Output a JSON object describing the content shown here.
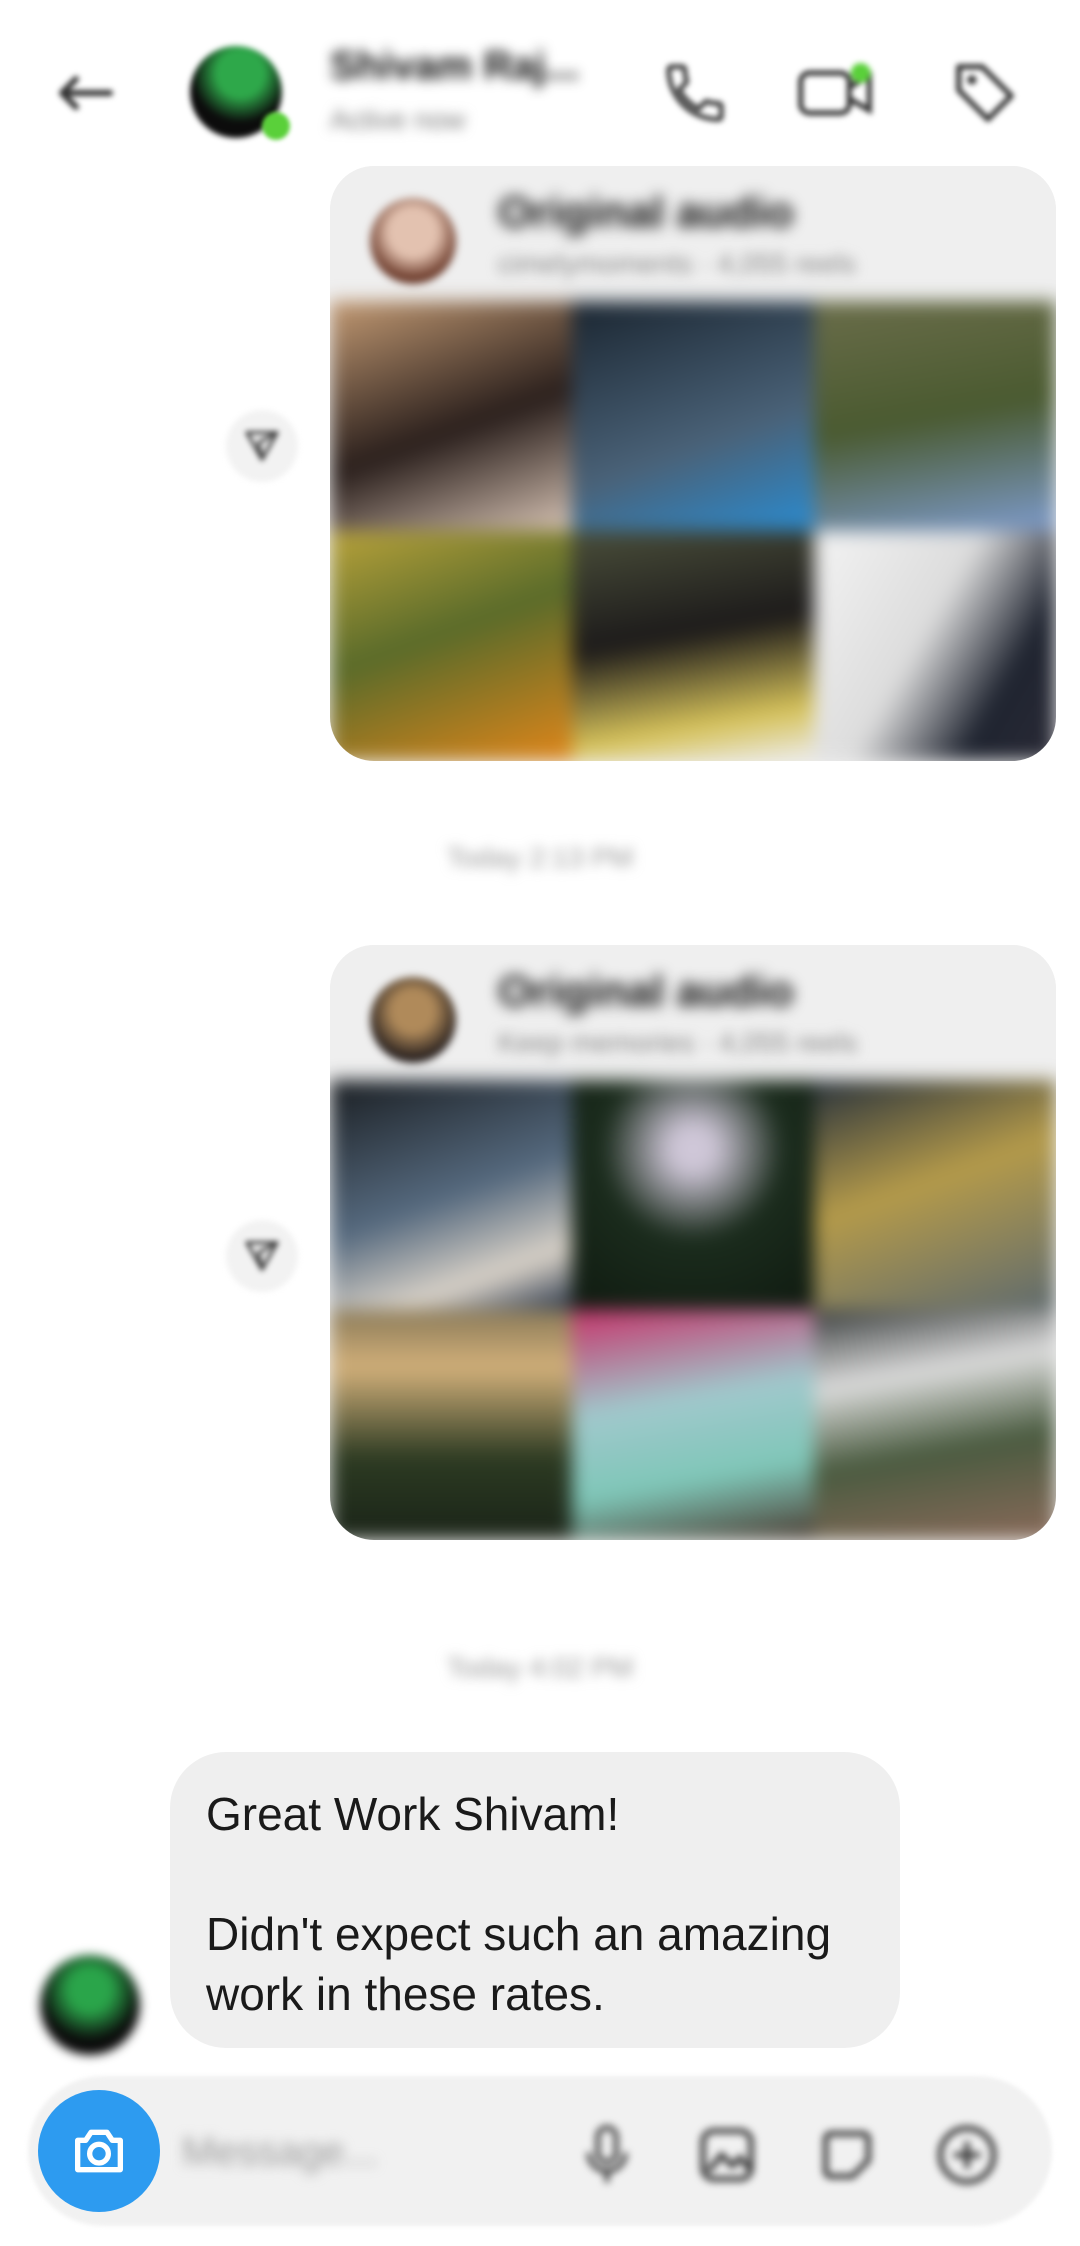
{
  "header": {
    "name": "Shivam Raj...",
    "status": "Active now"
  },
  "posts": [
    {
      "title": "Original audio",
      "subtitle": "cimelymoments · 4,055 reels",
      "colors": [
        "#8a6a4f",
        "#4a6278",
        "#5a6b3a",
        "#c7a33a",
        "#6b6a4a",
        "#e8e8e8"
      ]
    },
    {
      "title": "Original audio",
      "subtitle": "Keep memories · 4,055 reels",
      "colors": [
        "#35414f",
        "#1b2c1d",
        "#4b5b5e",
        "#6f6045",
        "#7fa2a9",
        "#495c44"
      ]
    }
  ],
  "timestamps": [
    "Today 2:13 PM",
    "Today 4:02 PM"
  ],
  "message": {
    "line1": "Great Work Shivam!",
    "line2": "Didn't expect such an amazing",
    "line3": "work in these rates."
  },
  "composer": {
    "placeholder": "Message..."
  },
  "colors": {
    "accent": "#2d9bf0",
    "bubble": "#efefef",
    "online": "#5ad03a"
  },
  "icons": [
    "back-arrow-icon",
    "phone-icon",
    "video-call-icon",
    "tag-icon",
    "share-icon",
    "camera-icon",
    "microphone-icon",
    "gallery-icon",
    "sticker-icon",
    "plus-icon"
  ]
}
